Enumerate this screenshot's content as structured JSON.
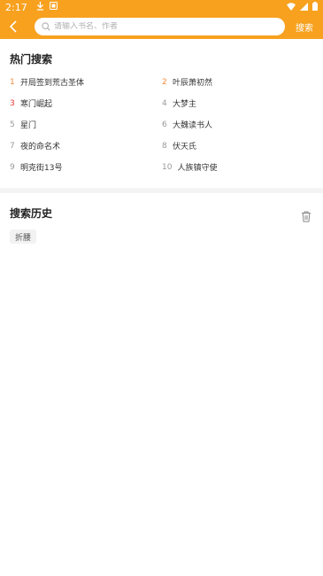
{
  "status_bar": {
    "time": "2:17",
    "icons": [
      "download-icon",
      "notification-icon",
      "wifi-icon",
      "signal-icon",
      "battery-icon"
    ]
  },
  "header": {
    "search_placeholder": "请输入书名、作者",
    "search_button": "搜索",
    "accent_color": "#f7a11f"
  },
  "hot": {
    "title": "热门搜索",
    "items": [
      {
        "rank": "1",
        "title": "开局签到荒古圣体",
        "highlight": true,
        "rank_color": "#f08a3a"
      },
      {
        "rank": "2",
        "title": "叶辰萧初然",
        "highlight": true,
        "rank_color": "#f08a3a"
      },
      {
        "rank": "3",
        "title": "寒门崛起",
        "highlight": true,
        "rank_color": "#e53935"
      },
      {
        "rank": "4",
        "title": "大梦主",
        "highlight": false
      },
      {
        "rank": "5",
        "title": "星门",
        "highlight": false
      },
      {
        "rank": "6",
        "title": "大魏读书人",
        "highlight": false
      },
      {
        "rank": "7",
        "title": "夜的命名术",
        "highlight": false
      },
      {
        "rank": "8",
        "title": "伏天氏",
        "highlight": false
      },
      {
        "rank": "9",
        "title": "明克街13号",
        "highlight": false
      },
      {
        "rank": "10",
        "title": "人族镇守使",
        "highlight": false
      }
    ]
  },
  "history": {
    "title": "搜索历史",
    "chips": [
      "折腰"
    ]
  }
}
